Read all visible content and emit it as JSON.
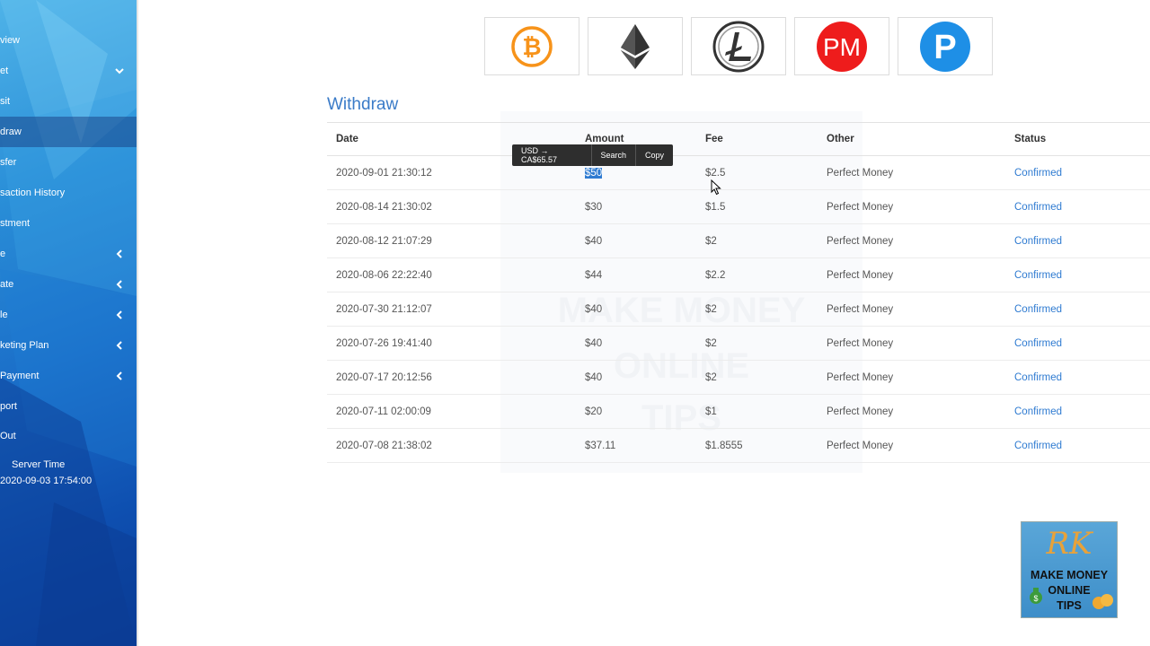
{
  "sidebar": {
    "items": [
      {
        "label": "view",
        "has_chevron": false
      },
      {
        "label": "et",
        "has_chevron": "down"
      },
      {
        "label": "sit",
        "has_chevron": false
      },
      {
        "label": "draw",
        "has_chevron": false,
        "active": true
      },
      {
        "label": "sfer",
        "has_chevron": false
      },
      {
        "label": "saction History",
        "has_chevron": false
      },
      {
        "label": "stment",
        "has_chevron": false
      },
      {
        "label": "e",
        "has_chevron": "left"
      },
      {
        "label": "ate",
        "has_chevron": "left"
      },
      {
        "label": "le",
        "has_chevron": "left"
      },
      {
        "label": "keting Plan",
        "has_chevron": "left"
      },
      {
        "label": "Payment",
        "has_chevron": "left"
      },
      {
        "label": "port",
        "has_chevron": false
      },
      {
        "label": "Out",
        "has_chevron": false
      }
    ],
    "server_time_label": "Server Time",
    "server_time_value": "2020-09-03 17:54:00"
  },
  "payment_methods": [
    {
      "name": "bitcoin-icon",
      "color": "#f7931a"
    },
    {
      "name": "ethereum-icon",
      "color": "#343434"
    },
    {
      "name": "litecoin-icon",
      "color": "#333333"
    },
    {
      "name": "perfect-money-icon",
      "color": "#ee1c1c",
      "text": "PM"
    },
    {
      "name": "payeer-icon",
      "color": "#1e8fe6",
      "text": "P"
    }
  ],
  "withdraw": {
    "title": "Withdraw",
    "headers": {
      "date": "Date",
      "amount": "Amount",
      "fee": "Fee",
      "other": "Other",
      "status": "Status"
    },
    "rows": [
      {
        "date": "2020-09-01 21:30:12",
        "amount": "$50",
        "fee": "$2.5",
        "other": "Perfect Money",
        "status": "Confirmed"
      },
      {
        "date": "2020-08-14 21:30:02",
        "amount": "$30",
        "fee": "$1.5",
        "other": "Perfect Money",
        "status": "Confirmed"
      },
      {
        "date": "2020-08-12 21:07:29",
        "amount": "$40",
        "fee": "$2",
        "other": "Perfect Money",
        "status": "Confirmed"
      },
      {
        "date": "2020-08-06 22:22:40",
        "amount": "$44",
        "fee": "$2.2",
        "other": "Perfect Money",
        "status": "Confirmed"
      },
      {
        "date": "2020-07-30 21:12:07",
        "amount": "$40",
        "fee": "$2",
        "other": "Perfect Money",
        "status": "Confirmed"
      },
      {
        "date": "2020-07-26 19:41:40",
        "amount": "$40",
        "fee": "$2",
        "other": "Perfect Money",
        "status": "Confirmed"
      },
      {
        "date": "2020-07-17 20:12:56",
        "amount": "$40",
        "fee": "$2",
        "other": "Perfect Money",
        "status": "Confirmed"
      },
      {
        "date": "2020-07-11 02:00:09",
        "amount": "$20",
        "fee": "$1",
        "other": "Perfect Money",
        "status": "Confirmed"
      },
      {
        "date": "2020-07-08 21:38:02",
        "amount": "$37.11",
        "fee": "$1.8555",
        "other": "Perfect Money",
        "status": "Confirmed"
      }
    ]
  },
  "selection_popup": {
    "conversion": "USD → CA$65.57",
    "search_label": "Search",
    "copy_label": "Copy"
  },
  "watermark": {
    "lines": [
      "MAKE MONEY",
      "ONLINE",
      "TIPS"
    ]
  },
  "channel_logo": {
    "monogram": "RK",
    "lines": [
      "MAKE MONEY",
      "ONLINE",
      "TIPS"
    ]
  },
  "colors": {
    "accent": "#2f7bd1",
    "title": "#3a7bc8"
  }
}
